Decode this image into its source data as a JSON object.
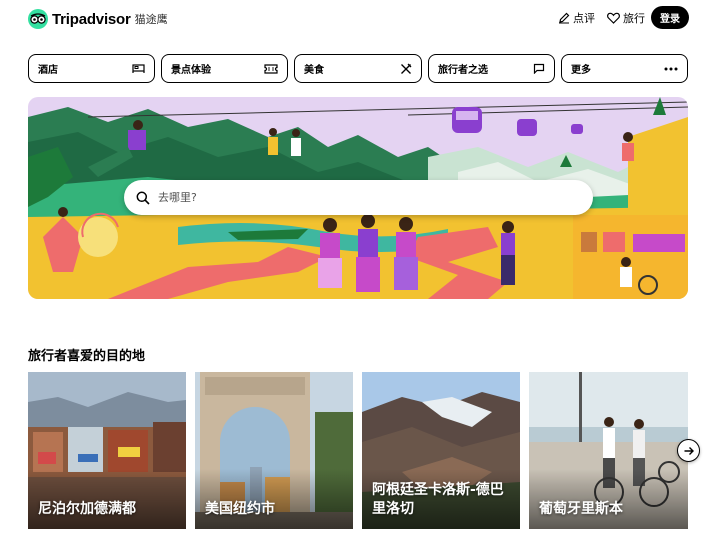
{
  "header": {
    "logo_text": "Tripadvisor",
    "logo_cn": "猫途鹰",
    "review_label": "点评",
    "trips_label": "旅行",
    "login_label": "登录"
  },
  "categories": [
    {
      "label": "酒店",
      "icon": "bed-icon"
    },
    {
      "label": "景点体验",
      "icon": "ticket-icon"
    },
    {
      "label": "美食",
      "icon": "utensils-icon"
    },
    {
      "label": "旅行者之选",
      "icon": "chat-icon"
    },
    {
      "label": "更多",
      "icon": "more-icon"
    }
  ],
  "search": {
    "placeholder": "去哪里?"
  },
  "section": {
    "title": "旅行者喜爱的目的地"
  },
  "destinations": [
    {
      "label": "尼泊尔加德满都"
    },
    {
      "label": "美国纽约市"
    },
    {
      "label": "阿根廷圣卡洛斯-德巴里洛切"
    },
    {
      "label": "葡萄牙里斯本"
    }
  ],
  "colors": {
    "brand": "#34e0a1",
    "hero_sky": "#e4d3f2",
    "hero_ground": "#f2c230"
  }
}
